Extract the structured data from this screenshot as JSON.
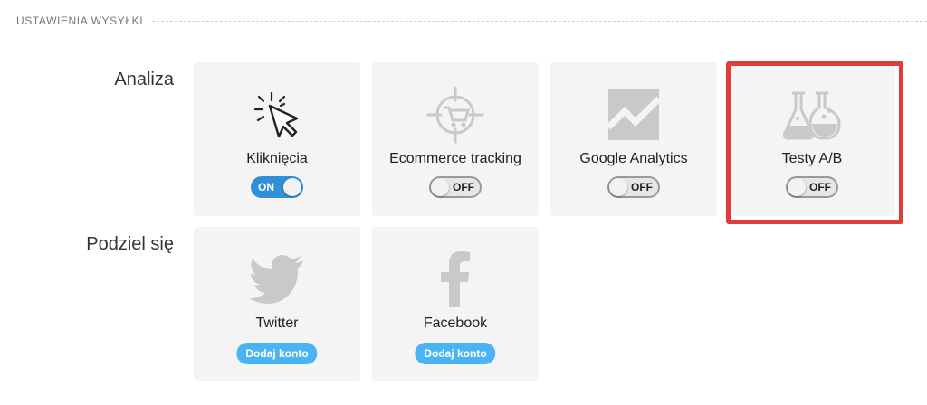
{
  "section": {
    "title": "USTAWIENIA WYSYŁKI"
  },
  "rows": {
    "analiza": {
      "label": "Analiza"
    },
    "podziel": {
      "label": "Podziel się"
    }
  },
  "cards": {
    "klikniecia": {
      "label": "Kliknięcia",
      "icon": "cursor-click-icon",
      "toggle": "ON",
      "state": "on"
    },
    "ecommerce": {
      "label": "Ecommerce tracking",
      "icon": "cart-target-icon",
      "toggle": "OFF",
      "state": "off"
    },
    "google": {
      "label": "Google Analytics",
      "icon": "analytics-chart-icon",
      "toggle": "OFF",
      "state": "off"
    },
    "testy": {
      "label": "Testy A/B",
      "icon": "flasks-icon",
      "toggle": "OFF",
      "state": "off"
    },
    "twitter": {
      "label": "Twitter",
      "icon": "twitter-bird-icon",
      "button": "Dodaj konto"
    },
    "facebook": {
      "label": "Facebook",
      "icon": "facebook-f-icon",
      "button": "Dodaj konto"
    }
  },
  "colors": {
    "toggle_on": "#2f8fd8",
    "button": "#4ab3f4",
    "highlight": "#e03c3c",
    "card_bg": "#f4f4f4"
  }
}
